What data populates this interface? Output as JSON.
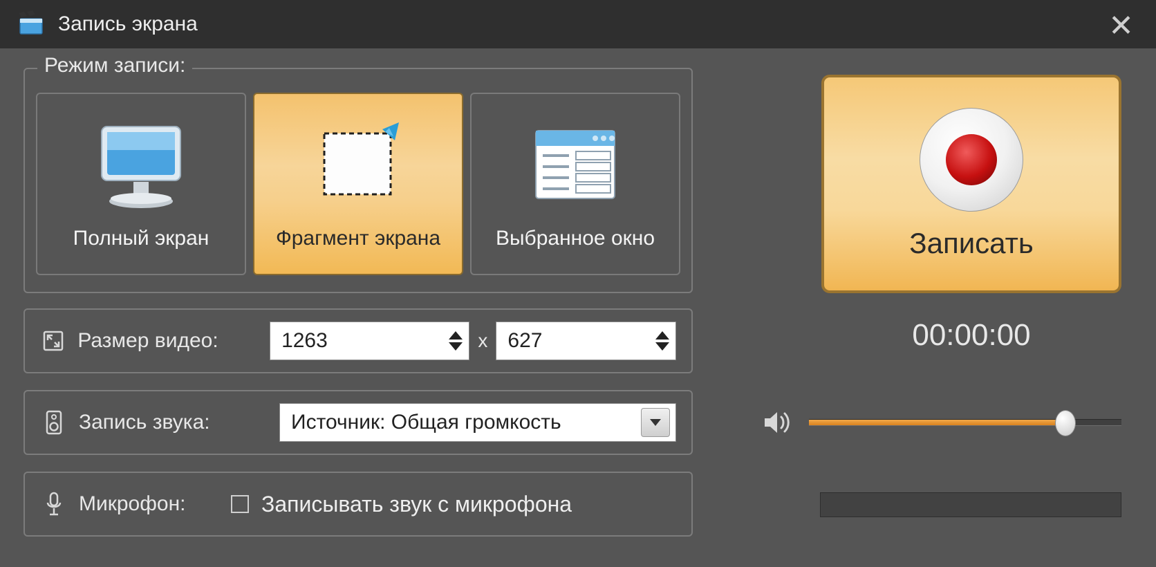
{
  "window": {
    "title": "Запись экрана"
  },
  "mode": {
    "legend": "Режим записи:",
    "fullscreen_label": "Полный экран",
    "fragment_label": "Фрагмент экрана",
    "window_label": "Выбранное окно",
    "selected": "fragment"
  },
  "record": {
    "label": "Записать",
    "timer": "00:00:00"
  },
  "video_size": {
    "label": "Размер видео:",
    "width": "1263",
    "height": "627",
    "separator": "x"
  },
  "audio": {
    "label": "Запись звука:",
    "source": "Источник: Общая громкость",
    "volume_percent": 82
  },
  "microphone": {
    "label": "Микрофон:",
    "checkbox_label": "Записывать звук с микрофона",
    "checked": false
  }
}
